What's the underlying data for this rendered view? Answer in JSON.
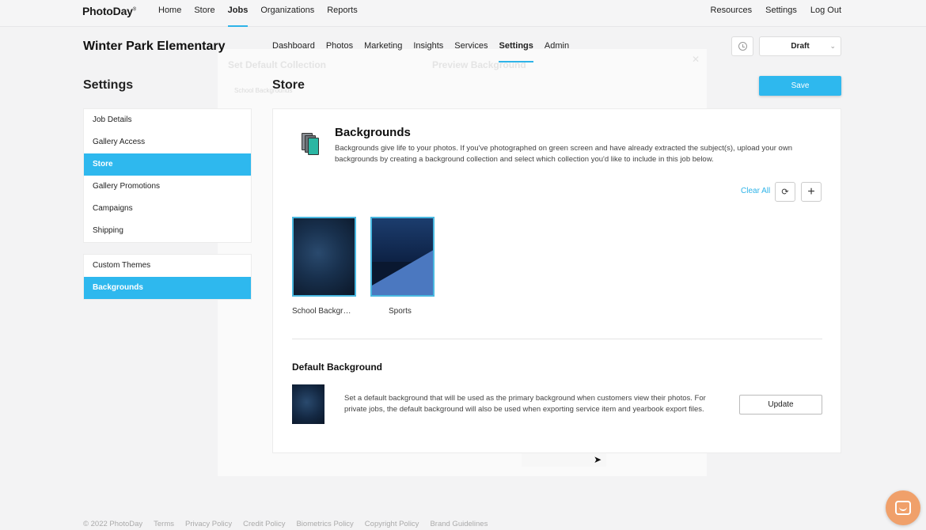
{
  "topnav": {
    "logo": "PhotoDay",
    "left": [
      "Home",
      "Store",
      "Jobs",
      "Organizations",
      "Reports"
    ],
    "active_left": "Jobs",
    "right": [
      "Resources",
      "Settings",
      "Log Out"
    ]
  },
  "header": {
    "school": "Winter Park Elementary",
    "subnav": [
      "Dashboard",
      "Photos",
      "Marketing",
      "Insights",
      "Services",
      "Settings",
      "Admin"
    ],
    "active_subnav": "Settings",
    "status": "Draft"
  },
  "page": {
    "settings_title": "Settings",
    "section_title": "Store",
    "save_label": "Save"
  },
  "sidebar": {
    "group1": [
      "Job Details",
      "Gallery Access",
      "Store",
      "Gallery Promotions",
      "Campaigns",
      "Shipping"
    ],
    "group2": [
      "Custom Themes",
      "Backgrounds"
    ],
    "active": [
      "Store",
      "Backgrounds"
    ]
  },
  "ghost": {
    "set_default": "Set Default Collection",
    "preview": "Preview Background",
    "select": "School Backgrounds"
  },
  "backgrounds": {
    "heading": "Backgrounds",
    "description": "Backgrounds give life to your photos. If you've photographed on green screen and have already extracted the subject(s), upload your own backgrounds by creating a background collection and select which collection you'd like to include in this job below.",
    "clear_all": "Clear All",
    "collections": [
      {
        "name": "School Backgr…"
      },
      {
        "name": "Sports"
      }
    ]
  },
  "default_background": {
    "heading": "Default Background",
    "description": "Set a default background that will be used as the primary background when customers view their photos. For private jobs, the default background will also be used when exporting service item and yearbook export files.",
    "update_label": "Update"
  },
  "footer": [
    "© 2022 PhotoDay",
    "Terms",
    "Privacy Policy",
    "Credit Policy",
    "Biometrics Policy",
    "Copyright Policy",
    "Brand Guidelines"
  ]
}
